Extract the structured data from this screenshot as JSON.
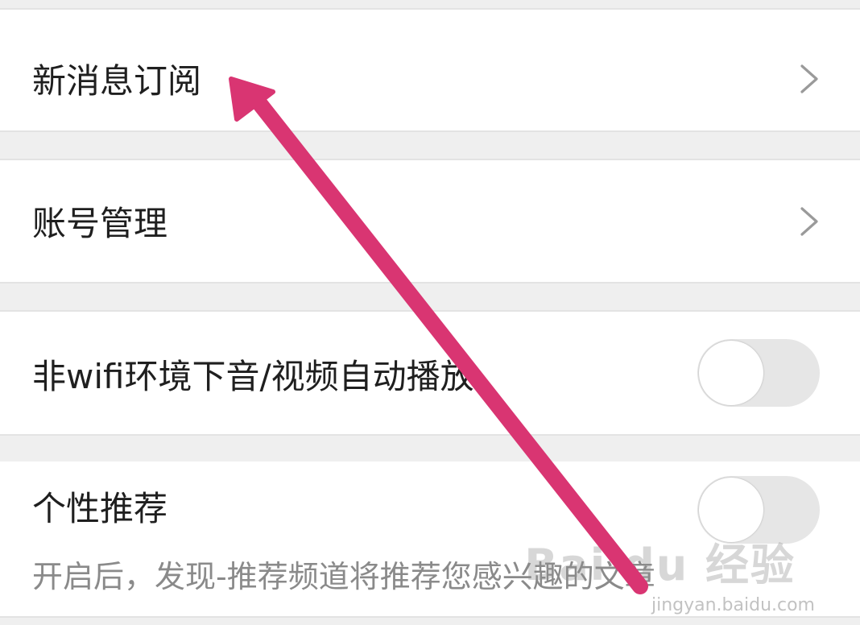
{
  "settings": {
    "items": [
      {
        "label": "新消息订阅",
        "control": "chevron-icon"
      },
      {
        "label": "账号管理",
        "control": "chevron-icon"
      },
      {
        "label": "非wifi环境下音/视频自动播放",
        "control": "toggle",
        "state": "off"
      },
      {
        "label": "个性推荐",
        "description": "开启后，发现-推荐频道将推荐您感兴趣的文章",
        "control": "toggle",
        "state": "off"
      }
    ]
  },
  "annotation": {
    "type": "arrow",
    "color": "#d93572",
    "points_to": "新消息订阅"
  },
  "watermark": {
    "logo": "Bai du 经验",
    "url": "jingyan.baidu.com"
  },
  "colors": {
    "background": "#efefef",
    "row_background": "#ffffff",
    "text_primary": "#1f1f1f",
    "text_secondary": "#8a8a8a",
    "toggle_off": "#e6e6e6",
    "chevron": "#9a9a9a"
  }
}
